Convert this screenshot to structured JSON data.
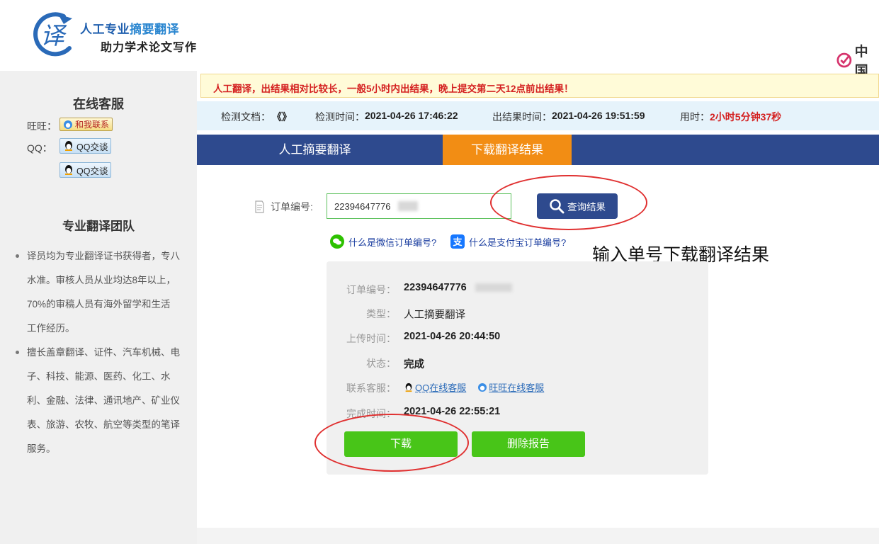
{
  "brand": {
    "logo_glyph": "译",
    "line1_part1": "人工专业",
    "line1_part2": "摘要翻译",
    "line2": "助力学术论文写作",
    "corner_text": "中国"
  },
  "sidebar": {
    "service_title": "在线客服",
    "wangwang_label": "旺旺：",
    "wangwang_button": "和我联系",
    "qq_label": "QQ：",
    "qq_button_1": "QQ交谈",
    "qq_button_2": "QQ交谈",
    "team_title": "专业翻译团队",
    "team_points": [
      "译员均为专业翻译证书获得者，专八水准。审核人员从业均达8年以上，70%的审稿人员有海外留学和生活工作经历。",
      "擅长盖章翻译、证件、汽车机械、电子、科技、能源、医药、化工、水利、金融、法律、通讯地产、矿业仪表、旅游、农牧、航空等类型的笔译服务。"
    ]
  },
  "notice": "人工翻译，出结果相对比较长，一般5小时内出结果，晚上提交第二天12点前出结果！",
  "infobar": {
    "doc_label": "检测文档：",
    "doc_value": "《》",
    "check_time_label": "检测时间：",
    "check_time_value": "2021-04-26 17:46:22",
    "result_time_label": "出结果时间：",
    "result_time_value": "2021-04-26 19:51:59",
    "elapsed_label": "用时：",
    "elapsed_value": "2小时5分钟37秒"
  },
  "tabs": [
    {
      "label": "人工摘要翻译"
    },
    {
      "label": "下载翻译结果"
    }
  ],
  "search": {
    "order_label": "订单编号:",
    "order_value": "22394647776",
    "query_button": "查询结果",
    "wechat_help": "什么是微信订单编号?",
    "alipay_help": "什么是支付宝订单编号?"
  },
  "annotation": "输入单号下载翻译结果",
  "result": {
    "order_label": "订单编号：",
    "order_value": "22394647776",
    "type_label": "类型：",
    "type_value": "人工摘要翻译",
    "upload_label": "上传时间：",
    "upload_value": "2021-04-26 20:44:50",
    "status_label": "状态：",
    "status_value": "完成",
    "contact_label": "联系客服：",
    "qq_service": "QQ在线客服",
    "wangwang_service": "旺旺在线客服",
    "finish_label": "完成时间：",
    "finish_value": "2021-04-26 22:55:21",
    "download_button": "下载",
    "delete_button": "删除报告"
  },
  "colors": {
    "nav": "#2e4a8e",
    "active_tab": "#f28d14",
    "green_button": "#48c518",
    "alert_red": "#d42020",
    "annotation_red": "#e03030"
  }
}
